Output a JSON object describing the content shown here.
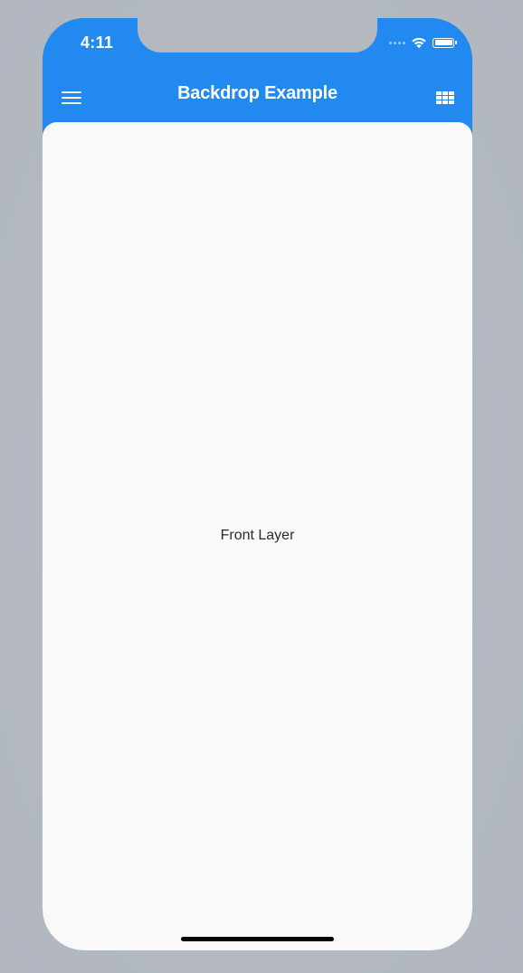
{
  "status_bar": {
    "time": "4:11"
  },
  "app_bar": {
    "title": "Backdrop Example",
    "leading_icon": "menu-icon",
    "trailing_icon": "grid-icon"
  },
  "front_layer": {
    "text": "Front Layer"
  },
  "colors": {
    "primary": "#2189ef",
    "surface": "#f9f9f9",
    "backdrop_outer": "#b3b8c1"
  }
}
